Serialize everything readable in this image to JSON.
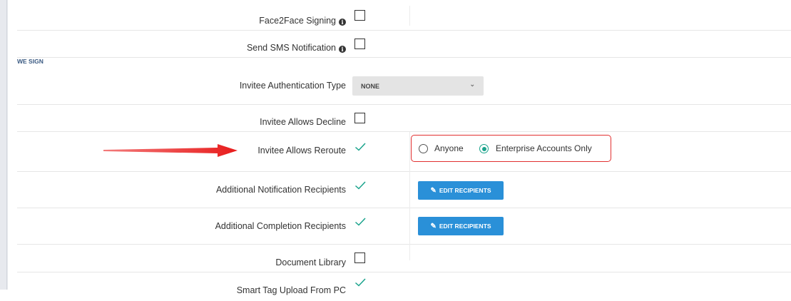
{
  "section_header": "WE SIGN",
  "rows": [
    {
      "label": "Face2Face Signing",
      "info": true,
      "state": "unchecked"
    },
    {
      "label": "Send SMS Notification",
      "info": true,
      "state": "unchecked"
    },
    {
      "label": "Invitee Authentication Type",
      "state": "select"
    },
    {
      "label": "Invitee Allows Decline",
      "state": "unchecked"
    },
    {
      "label": "Invitee Allows Reroute",
      "state": "checked"
    },
    {
      "label": "Additional Notification Recipients",
      "state": "checked"
    },
    {
      "label": "Additional Completion Recipients",
      "state": "checked"
    },
    {
      "label": "Document Library",
      "state": "unchecked"
    },
    {
      "label": "Smart Tag Upload From PC",
      "state": "checked"
    }
  ],
  "auth_select": {
    "value": "NONE"
  },
  "reroute_options": [
    {
      "label": "Anyone",
      "selected": false
    },
    {
      "label": "Enterprise Accounts Only",
      "selected": true
    }
  ],
  "edit_recipients_label": "EDIT RECIPIENTS",
  "colors": {
    "check": "#1aa38c",
    "button": "#2a90d8",
    "highlight": "#e23030",
    "arrow": "#e81c1c",
    "section_header": "#3a5a82"
  },
  "icons": {
    "info": "info-icon",
    "check": "check-icon",
    "edit": "edit-icon",
    "arrow": "arrow-icon",
    "chevron": "chevron-down-icon"
  }
}
